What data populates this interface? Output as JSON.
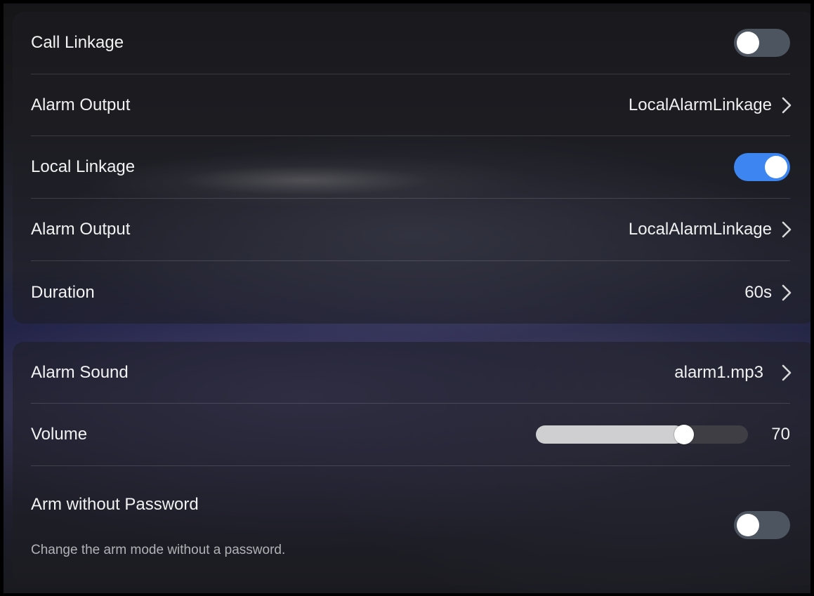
{
  "linkage_card": {
    "call_linkage": {
      "label": "Call Linkage",
      "enabled": false
    },
    "alarm_output_1": {
      "label": "Alarm Output",
      "value": "LocalAlarmLinkage"
    },
    "local_linkage": {
      "label": "Local Linkage",
      "enabled": true
    },
    "alarm_output_2": {
      "label": "Alarm Output",
      "value": "LocalAlarmLinkage"
    },
    "duration": {
      "label": "Duration",
      "value": "60s"
    }
  },
  "sound_card": {
    "alarm_sound": {
      "label": "Alarm Sound",
      "value": "alarm1.mp3"
    },
    "volume": {
      "label": "Volume",
      "value": "70",
      "level": 0.7
    },
    "arm_without_password": {
      "label": "Arm without Password",
      "description": "Change the arm mode without a password.",
      "enabled": false
    }
  },
  "icons": {
    "chevron": "chevron-right-icon"
  },
  "colors": {
    "toggle_on": "#3d86f2",
    "toggle_off": "#4d5560",
    "slider_fill": "#cfcfd1",
    "slider_track": "#3e3e44"
  }
}
